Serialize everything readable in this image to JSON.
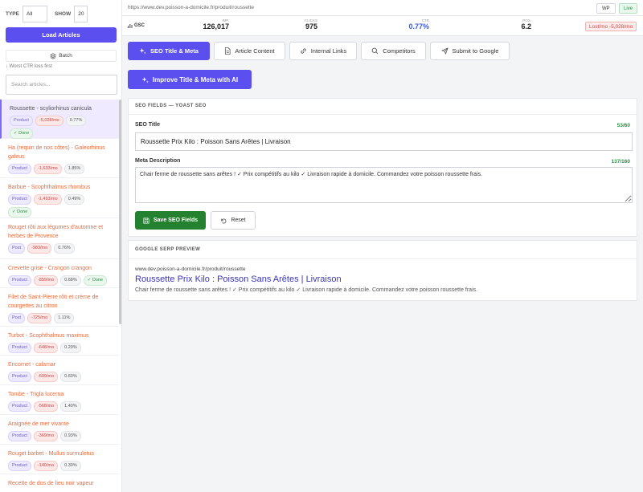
{
  "sidebar": {
    "type_label": "TYPE",
    "type_value": "All",
    "show_label": "SHOW",
    "show_value": "20",
    "load_button": "Load Articles",
    "batch_button": "Batch",
    "sort_hint": "↓ Worst CTR loss first",
    "search_placeholder": "Search articles...",
    "items": [
      {
        "title": "Roussette - scyliorhinus canicula",
        "type": "Product",
        "loss": "-5,028/mo",
        "ctr": "0.77%",
        "done": "✓ Done"
      },
      {
        "title": "Ha (requin de nos côtes) - Galeorhinus galeus",
        "type": "Product",
        "loss": "-1,633/mo",
        "ctr": "1.85%",
        "done": ""
      },
      {
        "title": "Barbue - Scophthalmus rhombus",
        "type": "Product",
        "loss": "-1,493/mo",
        "ctr": "0.49%",
        "done": "✓ Done"
      },
      {
        "title": "Rouget rôti aux légumes d'automne et herbes de Provence",
        "type": "Post",
        "loss": "-983/mo",
        "ctr": "0.76%",
        "done": ""
      },
      {
        "title": "Crevette grise - Crangon crangon",
        "type": "Product",
        "loss": "-859/mo",
        "ctr": "0.68%",
        "done": "✓ Done"
      },
      {
        "title": "Filet de Saint-Pierre rôti et crème de courgettes au citron",
        "type": "Post",
        "loss": "-725/mo",
        "ctr": "1.11%",
        "done": ""
      },
      {
        "title": "Turbot - Scophthalmus maximus",
        "type": "Product",
        "loss": "-648/mo",
        "ctr": "0.29%",
        "done": ""
      },
      {
        "title": "Encornet - calamar",
        "type": "Product",
        "loss": "-609/mo",
        "ctr": "0.60%",
        "done": ""
      },
      {
        "title": "Tombe - Trigla lucerna",
        "type": "Product",
        "loss": "-568/mo",
        "ctr": "1.40%",
        "done": ""
      },
      {
        "title": "Araignée de mer vivante",
        "type": "Product",
        "loss": "-369/mo",
        "ctr": "0.93%",
        "done": ""
      },
      {
        "title": "Rouget barbet - Mullus surmuletus",
        "type": "Product",
        "loss": "-140/mo",
        "ctr": "0.30%",
        "done": ""
      },
      {
        "title": "Recette de dos de lieu noir vapeur",
        "type": "Post",
        "loss": "",
        "ctr": "",
        "done": ""
      }
    ]
  },
  "header": {
    "url": "https://www.dev.poisson-a-domicile.fr/produit/roussette",
    "wp_button": "WP",
    "live_button": "Live"
  },
  "stats": {
    "source": "GSC",
    "impressions_label": "IMP.",
    "impressions": "126,017",
    "clicks_label": "CLICKS",
    "clicks": "975",
    "ctr_label": "CTR",
    "ctr": "0.77%",
    "position_label": "POS.",
    "position": "6.2",
    "lost": "Lost/mo -5,028/mo"
  },
  "tabs": [
    {
      "label": "SEO Title & Meta",
      "icon": "sparkles-icon"
    },
    {
      "label": "Article Content",
      "icon": "document-icon"
    },
    {
      "label": "Internal Links",
      "icon": "link-icon"
    },
    {
      "label": "Competitors",
      "icon": "search-icon"
    },
    {
      "label": "Submit to Google",
      "icon": "send-icon"
    }
  ],
  "improve_button": "Improve Title & Meta with AI",
  "seo_fields": {
    "heading": "SEO FIELDS — YOAST SEO",
    "title_label": "SEO Title",
    "title_counter": "53/60",
    "title_value": "Roussette Prix Kilo : Poisson Sans Arêtes | Livraison",
    "desc_label": "Meta Description",
    "desc_counter": "137/160",
    "desc_value": "Chair ferme de roussette sans arêtes ! ✓ Prix compétitifs au kilo ✓ Livraison rapide à domicile. Commandez votre poisson roussette frais.",
    "save_button": "Save SEO Fields",
    "reset_button": "Reset"
  },
  "serp": {
    "heading": "GOOGLE SERP PREVIEW",
    "url": "www.dev.poisson-a-domicile.fr/produit/roussette",
    "title": "Roussette Prix Kilo : Poisson Sans Arêtes | Livraison",
    "desc": "Chair ferme de roussette sans arêtes ! ✓ Prix compétitifs au kilo ✓ Livraison rapide à domicile. Commandez votre poisson roussette frais."
  },
  "colors": {
    "accent": "#5b4ff0",
    "save": "#24812f",
    "loss": "#d14343",
    "serp_title": "#3b36b8"
  }
}
